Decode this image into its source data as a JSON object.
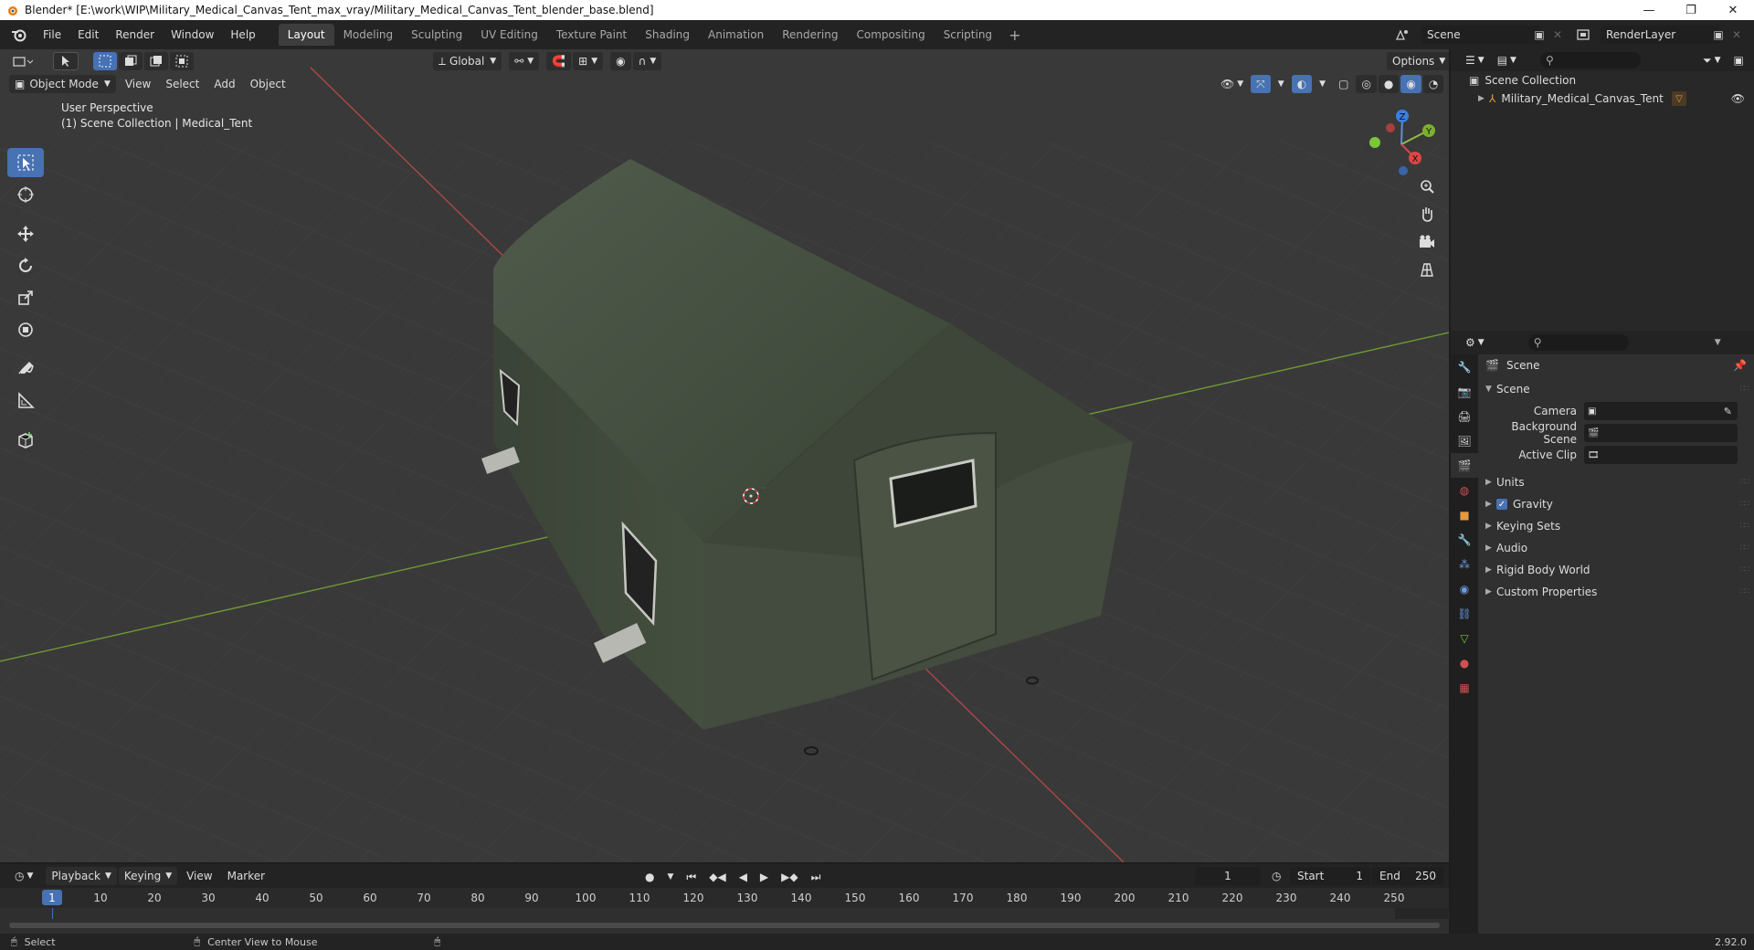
{
  "window": {
    "title": "Blender* [E:\\work\\WIP\\Military_Medical_Canvas_Tent_max_vray/Military_Medical_Canvas_Tent_blender_base.blend]",
    "controls": [
      "—",
      "❐",
      "✕"
    ]
  },
  "menu": [
    "File",
    "Edit",
    "Render",
    "Window",
    "Help"
  ],
  "workspaces": [
    "Layout",
    "Modeling",
    "Sculpting",
    "UV Editing",
    "Texture Paint",
    "Shading",
    "Animation",
    "Rendering",
    "Compositing",
    "Scripting"
  ],
  "active_workspace": "Layout",
  "scene_name": "Scene",
  "render_layer": "RenderLayer",
  "viewport": {
    "transform_orientation": "Global",
    "options_label": "Options",
    "mode": "Object Mode",
    "menus": [
      "View",
      "Select",
      "Add",
      "Object"
    ],
    "view_name": "User Perspective",
    "collection_info": "(1) Scene Collection | Medical_Tent",
    "gizmo_axes": {
      "x": "X",
      "y": "Y",
      "z": "Z"
    }
  },
  "outliner": {
    "root": "Scene Collection",
    "item": "Military_Medical_Canvas_Tent"
  },
  "properties": {
    "context_title": "Scene",
    "panel_title": "Scene",
    "fields": [
      {
        "label": "Camera"
      },
      {
        "label": "Background Scene"
      },
      {
        "label": "Active Clip"
      }
    ],
    "sections": [
      {
        "label": "Units",
        "checkbox": false
      },
      {
        "label": "Gravity",
        "checkbox": true
      },
      {
        "label": "Keying Sets",
        "checkbox": false
      },
      {
        "label": "Audio",
        "checkbox": false
      },
      {
        "label": "Rigid Body World",
        "checkbox": false
      },
      {
        "label": "Custom Properties",
        "checkbox": false
      }
    ]
  },
  "timeline": {
    "menus": [
      "Playback",
      "Keying",
      "View",
      "Marker"
    ],
    "current_frame": "1",
    "start_label": "Start",
    "start": "1",
    "end_label": "End",
    "end": "250",
    "ticks": [
      "10",
      "20",
      "30",
      "40",
      "50",
      "60",
      "70",
      "80",
      "90",
      "100",
      "110",
      "120",
      "130",
      "140",
      "150",
      "160",
      "170",
      "180",
      "190",
      "200",
      "210",
      "220",
      "230",
      "240",
      "250"
    ],
    "cursor_label": "1"
  },
  "status": {
    "left": "Select",
    "middle": "Center View to Mouse",
    "version": "2.92.0"
  },
  "colors": {
    "accent": "#4772b3",
    "viewport_bg": "#393939",
    "axis_x": "#c84a4a",
    "axis_y": "#7aa33a",
    "tent": "#3f4a3b"
  }
}
